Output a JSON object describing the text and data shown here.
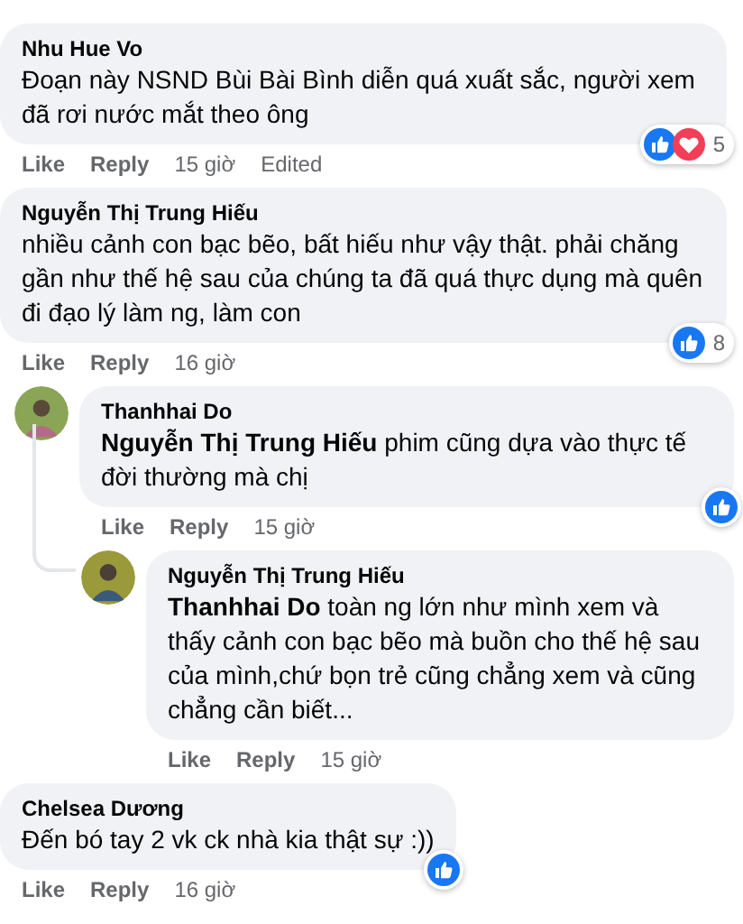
{
  "comments": [
    {
      "author": "Nhu Hue Vo",
      "text": "Đoạn này NSND Bùi Bài Bình diễn quá xuất sắc, người xem đã rơi nước mắt theo ông",
      "actions": [
        "Like",
        "Reply"
      ],
      "time": "15 giờ",
      "edited": "Edited",
      "reactions": {
        "kinds": [
          {
            "kind": "like"
          },
          {
            "kind": "love"
          }
        ],
        "count": "5"
      }
    },
    {
      "author": "Nguyễn Thị Trung Hiếu",
      "text": "nhiều cảnh con bạc bẽo, bất hiếu như vậy thật. phải chăng gần như thế hệ sau của chúng ta đã quá thực dụng mà quên đi đạo lý làm ng, làm con",
      "actions": [
        "Like",
        "Reply"
      ],
      "time": "16 giờ",
      "reactions": {
        "kinds": [
          {
            "kind": "like"
          }
        ],
        "count": "8"
      },
      "replies": [
        {
          "author": "Thanhhai Do",
          "text": "**Nguyễn Thị Trung Hiếu** phim cũng dựa vào thực tế đời thường mà chị",
          "actions": [
            "Like",
            "Reply"
          ],
          "time": "15 giờ",
          "reactions": {
            "kinds": [
              {
                "kind": "like"
              }
            ]
          },
          "replies": [
            {
              "author": "Nguyễn Thị Trung Hiếu",
              "text": "**Thanhhai Do** toàn ng lớn như mình xem và thấy cảnh con bạc bẽo mà buồn cho thế hệ sau của mình,chứ bọn trẻ cũng chẳng xem và cũng chẳng cần biết...",
              "actions": [
                "Like",
                "Reply"
              ],
              "time": "15 giờ"
            }
          ]
        }
      ]
    },
    {
      "author": "Chelsea Dương",
      "text": "Đến bó tay 2 vk ck nhà kia thật sự :))",
      "actions": [
        "Like",
        "Reply"
      ],
      "time": "16 giờ",
      "reactions": {
        "kinds": [
          {
            "kind": "like"
          }
        ]
      }
    }
  ]
}
